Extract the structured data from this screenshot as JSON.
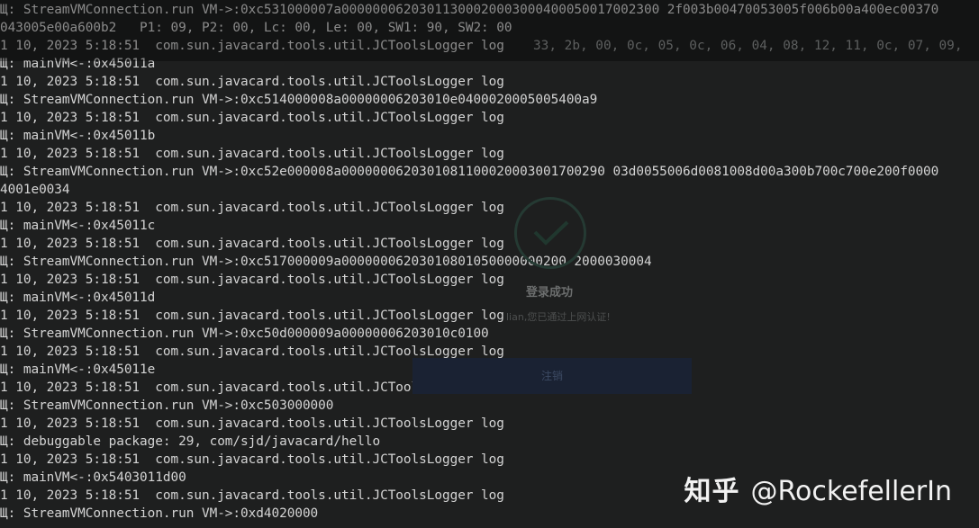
{
  "console": {
    "lines": [
      "Щ: StreamVMConnection.run VM->:0xc531000007a00000006203011300020003000400050017002300 2f003b00470053005f006b00a400ec00370",
      "043005e00a600b2   P1: 09, P2: 00, Lc: 00, Le: 00, SW1: 90, SW2: 00",
      "1 10, 2023 5:18:51  com.sun.javacard.tools.util.JCToolsLogger log",
      "Щ: mainVM<-:0x45011a",
      "1 10, 2023 5:18:51  com.sun.javacard.tools.util.JCToolsLogger log",
      "Щ: StreamVMConnection.run VM->:0xc514000008a00000006203010e0400020005005400a9",
      "1 10, 2023 5:18:51  com.sun.javacard.tools.util.JCToolsLogger log",
      "Щ: mainVM<-:0x45011b",
      "1 10, 2023 5:18:51  com.sun.javacard.tools.util.JCToolsLogger log",
      "Щ: StreamVMConnection.run VM->:0xc52e000008a0000000620301081100020003001700290 03d0055006d0081008d00a300b700c700e200f0000",
      "4001e0034",
      "1 10, 2023 5:18:51  com.sun.javacard.tools.util.JCToolsLogger log",
      "Щ: mainVM<-:0x45011c",
      "1 10, 2023 5:18:51  com.sun.javacard.tools.util.JCToolsLogger log",
      "Щ: StreamVMConnection.run VM->:0xc517000009a00000006203010801050000000200 2000030004",
      "1 10, 2023 5:18:51  com.sun.javacard.tools.util.JCToolsLogger log",
      "Щ: mainVM<-:0x45011d",
      "1 10, 2023 5:18:51  com.sun.javacard.tools.util.JCToolsLogger log",
      "Щ: StreamVMConnection.run VM->:0xc50d000009a00000006203010c0100",
      "1 10, 2023 5:18:51  com.sun.javacard.tools.util.JCToolsLogger log",
      "Щ: mainVM<-:0x45011e",
      "1 10, 2023 5:18:51  com.sun.javacard.tools.util.JCToolsLogger log",
      "Щ: StreamVMConnection.run VM->:0xc503000000",
      "1 10, 2023 5:18:51  com.sun.javacard.tools.util.JCToolsLogger log",
      "Щ: debuggable package: 29, com/sjd/javacard/hello",
      "1 10, 2023 5:18:51  com.sun.javacard.tools.util.JCToolsLogger log",
      "Щ: mainVM<-:0x5403011d00",
      "1 10, 2023 5:18:51  com.sun.javacard.tools.util.JCToolsLogger log",
      "Щ: StreamVMConnection.run VM->:0xd4020000"
    ],
    "ghost_row": "33, 2b, 00, 0c, 05, 0c, 06, 04, 08, 12, 11, 0c, 07, 09,"
  },
  "overlay": {
    "title": "登录成功",
    "subtitle": "lian,您已通过上网认证!",
    "button_label": "注销"
  },
  "watermark": {
    "platform": "知乎",
    "handle": "@RockefellerIn"
  },
  "colors": {
    "background": "#1e1f1f",
    "text": "#d4d4d4",
    "watermark": "#f2f2f2"
  }
}
